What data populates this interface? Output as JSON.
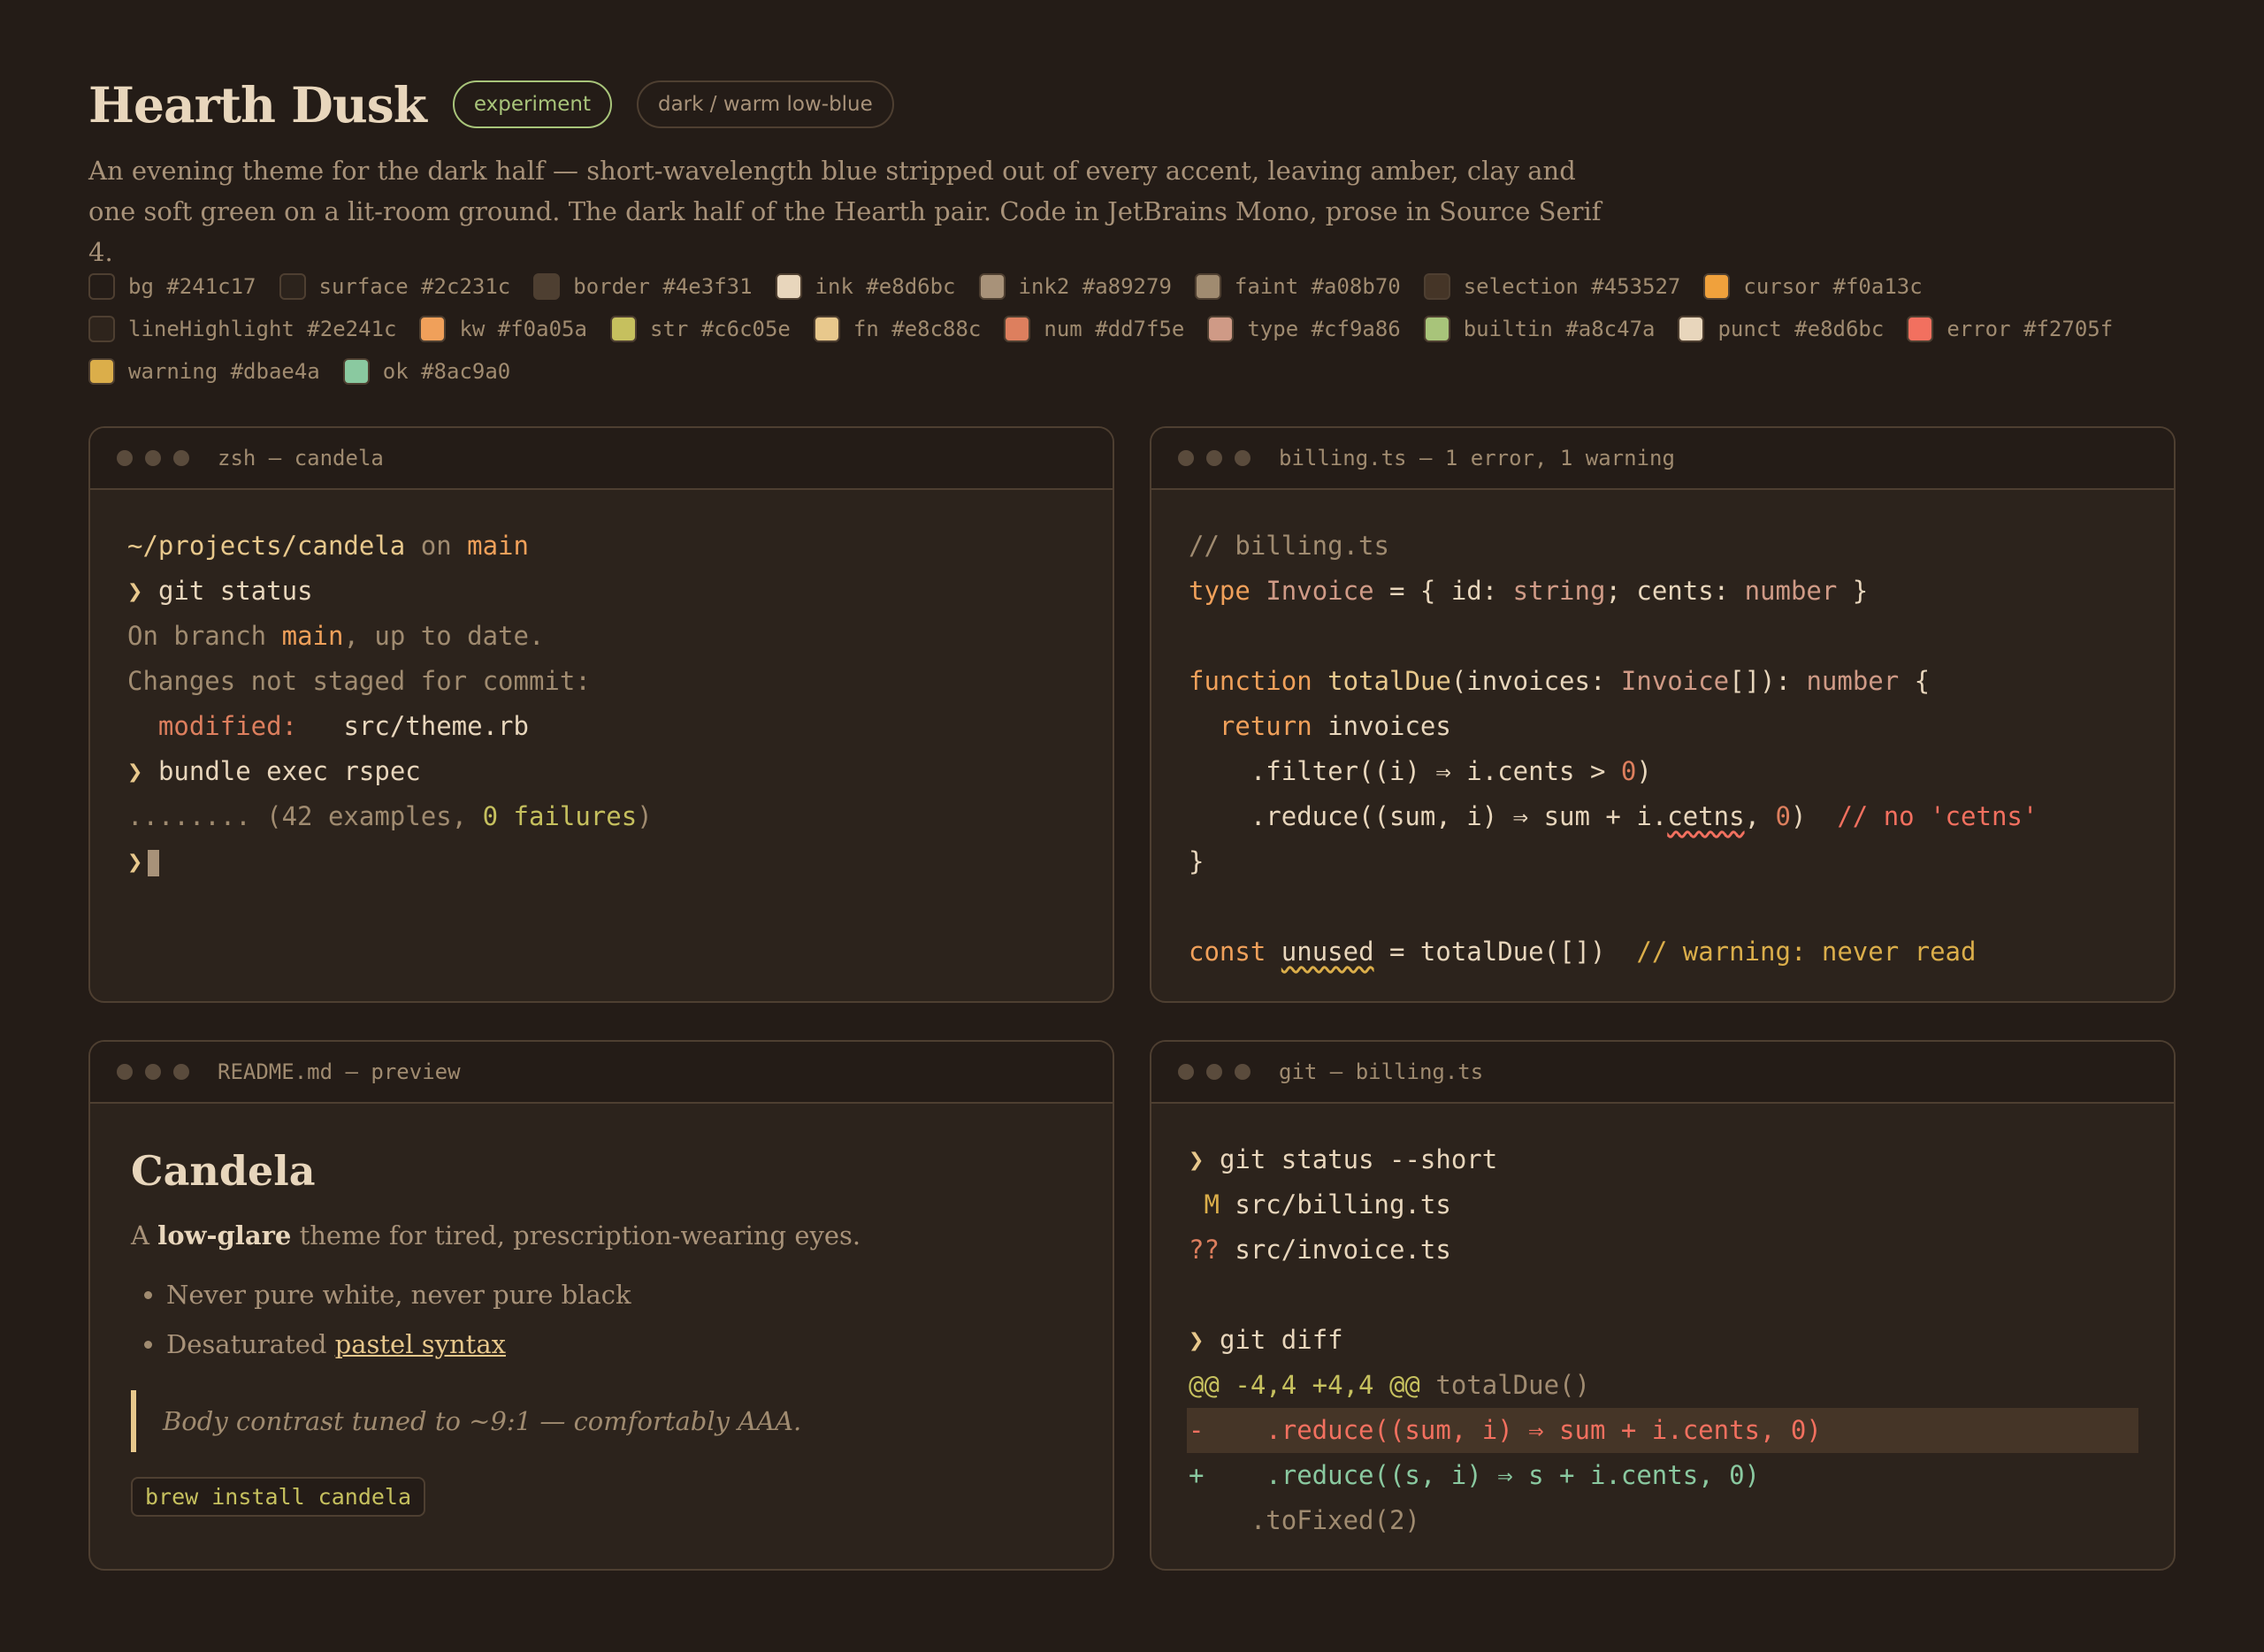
{
  "header": {
    "title": "Hearth Dusk",
    "badge_experiment": "experiment",
    "badge_mode": "dark / warm low-blue",
    "description": "An evening theme for the dark half — short-wavelength blue stripped out of every accent, leaving amber, clay and one soft green on a lit-room ground. The dark half of the Hearth pair. Code in JetBrains Mono, prose in Source Serif 4."
  },
  "swatches": [
    {
      "label": "bg #241c17",
      "color": "#241c17"
    },
    {
      "label": "surface #2c231c",
      "color": "#2c231c"
    },
    {
      "label": "border #4e3f31",
      "color": "#4e3f31"
    },
    {
      "label": "ink #e8d6bc",
      "color": "#e8d6bc"
    },
    {
      "label": "ink2 #a89279",
      "color": "#a89279"
    },
    {
      "label": "faint #a08b70",
      "color": "#a08b70"
    },
    {
      "label": "selection #453527",
      "color": "#453527"
    },
    {
      "label": "cursor #f0a13c",
      "color": "#f0a13c"
    },
    {
      "label": "lineHighlight #2e241c",
      "color": "#2e241c"
    },
    {
      "label": "kw #f0a05a",
      "color": "#f0a05a"
    },
    {
      "label": "str #c6c05e",
      "color": "#c6c05e"
    },
    {
      "label": "fn #e8c88c",
      "color": "#e8c88c"
    },
    {
      "label": "num #dd7f5e",
      "color": "#dd7f5e"
    },
    {
      "label": "type #cf9a86",
      "color": "#cf9a86"
    },
    {
      "label": "builtin #a8c47a",
      "color": "#a8c47a"
    },
    {
      "label": "punct #e8d6bc",
      "color": "#e8d6bc"
    },
    {
      "label": "error #f2705f",
      "color": "#f2705f"
    },
    {
      "label": "warning #dbae4a",
      "color": "#dbae4a"
    },
    {
      "label": "ok #8ac9a0",
      "color": "#8ac9a0"
    }
  ],
  "terminal": {
    "title": "zsh — candela",
    "path": "~/projects/candela",
    "on": "on",
    "branch": "main",
    "prompt": "❯",
    "cmd1": "git status",
    "line_branch_pre": "On branch ",
    "line_branch_name": "main",
    "line_branch_post": ", up to date.",
    "line_changes": "Changes not staged for commit:",
    "modified_label": "  modified:",
    "modified_file": "   src/theme.rb",
    "cmd2": "bundle exec rspec",
    "dots": "........ (42 examples, ",
    "failures": "0 failures",
    "close_paren": ")"
  },
  "editor": {
    "title": "billing.ts — 1 error, 1 warning",
    "comment": "// billing.ts",
    "kw_type": "type",
    "type_name": "Invoice",
    "eq_brace": " = { id: ",
    "string_t": "string",
    "semi_cents": "; cents: ",
    "number_t": "number",
    "close_brace": " }",
    "kw_function": "function",
    "fn_name": "totalDue",
    "params_pre": "(invoices: ",
    "invoice_t": "Invoice",
    "params_post": "[]): ",
    "ret_number": "number",
    "open_brace": " {",
    "kw_return": "  return",
    "invoices": " invoices",
    "filter_pre": "    .filter((i) ⇒ i.cents > ",
    "zero": "0",
    "paren_close": ")",
    "reduce_pre": "    .reduce((sum, i) ⇒ sum + i.",
    "typo": "cetns",
    "comma": ", ",
    "reduce_zero": "0",
    "reduce_close": ")  ",
    "err_comment": "// no 'cetns'",
    "brace_end": "}",
    "kw_const": "const",
    "unused": "unused",
    "assign": " = totalDue([])  ",
    "warn_comment": "// warning: never read"
  },
  "readme": {
    "title": "README.md — preview",
    "h1": "Candela",
    "para_pre": "A ",
    "para_bold": "low-glare",
    "para_post": " theme for tired, prescription-wearing eyes.",
    "bullet1": "Never pure white, never pure black",
    "bullet2_pre": "Desaturated ",
    "bullet2_link": "pastel syntax",
    "quote": "Body contrast tuned to ~9:1 — comfortably AAA.",
    "code": "brew install candela"
  },
  "git": {
    "title": "git — billing.ts",
    "prompt": "❯",
    "cmd1": "git status --short",
    "m_flag": " M",
    "m_file": " src/billing.ts",
    "q_flag": "??",
    "q_file": " src/invoice.ts",
    "cmd2": "git diff",
    "hunk": "@@ -4,4 +4,4 @@",
    "hunk_fn": " totalDue()",
    "del": "-    .reduce((sum, i) ⇒ sum + i.cents, 0)",
    "add": "+    .reduce((s, i) ⇒ s + i.cents, 0)",
    "ctx": "    .toFixed(2)"
  }
}
